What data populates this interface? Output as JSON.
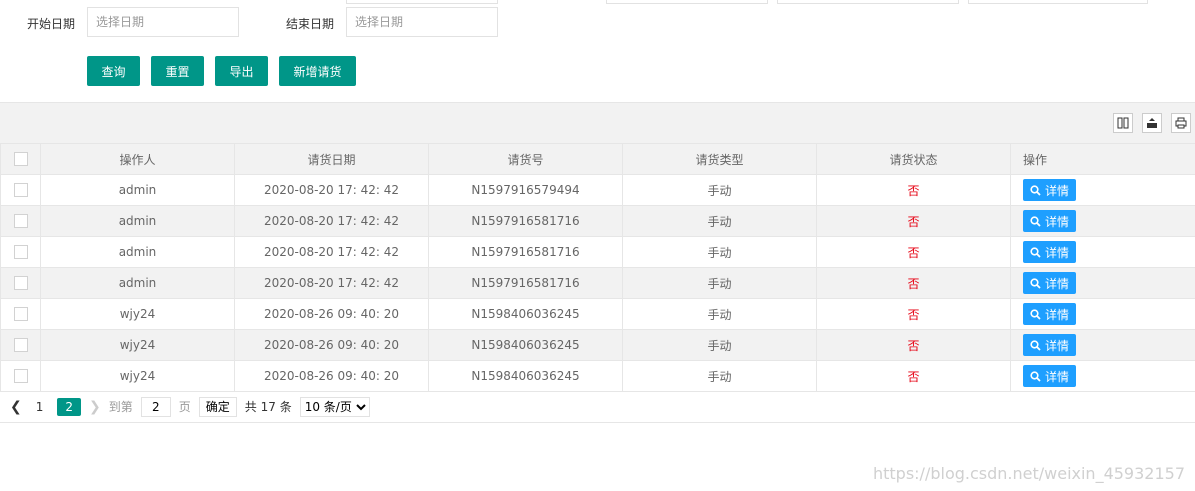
{
  "filters": {
    "start_label": "开始日期",
    "start_placeholder": "选择日期",
    "end_label": "结束日期",
    "end_placeholder": "选择日期"
  },
  "buttons": {
    "query": "查询",
    "reset": "重置",
    "export": "导出",
    "add": "新增请货"
  },
  "toolbar_icons": [
    "columns-icon",
    "export-icon",
    "print-icon"
  ],
  "table": {
    "headers": [
      "操作人",
      "请货日期",
      "请货号",
      "请货类型",
      "请货状态",
      "操作"
    ],
    "rows": [
      [
        "admin",
        "2020-08-20 17: 42: 42",
        "N1597916579494",
        "手动",
        "否"
      ],
      [
        "admin",
        "2020-08-20 17: 42: 42",
        "N1597916581716",
        "手动",
        "否"
      ],
      [
        "admin",
        "2020-08-20 17: 42: 42",
        "N1597916581716",
        "手动",
        "否"
      ],
      [
        "admin",
        "2020-08-20 17: 42: 42",
        "N1597916581716",
        "手动",
        "否"
      ],
      [
        "wjy24",
        "2020-08-26 09: 40: 20",
        "N1598406036245",
        "手动",
        "否"
      ],
      [
        "wjy24",
        "2020-08-26 09: 40: 20",
        "N1598406036245",
        "手动",
        "否"
      ],
      [
        "wjy24",
        "2020-08-26 09: 40: 20",
        "N1598406036245",
        "手动",
        "否"
      ]
    ],
    "detail_label": "详情"
  },
  "pager": {
    "page1": "1",
    "page2": "2",
    "goto": "到第",
    "goto_value": "2",
    "page_unit": "页",
    "confirm": "确定",
    "total": "共 17 条",
    "page_size": "10 条/页"
  },
  "watermark": "https://blog.csdn.net/weixin_45932157",
  "colors": {
    "primary": "#009688",
    "detail": "#1e9fff",
    "status_no": "#e60012"
  }
}
